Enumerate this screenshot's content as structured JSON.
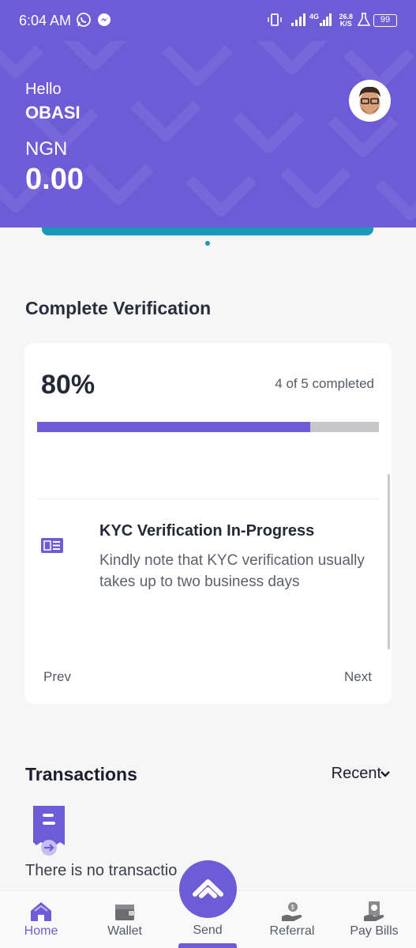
{
  "status_bar": {
    "time": "6:04 AM",
    "network": "4G",
    "speed": "26.8",
    "speed_unit": "K/S",
    "battery": "99"
  },
  "header": {
    "greeting": "Hello",
    "name": "OBASI",
    "currency": "NGN",
    "balance": "0.00"
  },
  "verification": {
    "title": "Complete Verification",
    "percent": "80%",
    "progress_fraction": 0.8,
    "count_text": "4 of 5 completed",
    "step": {
      "title": "KYC Verification In-Progress",
      "description": "Kindly note that KYC verification usually takes up to two business days"
    },
    "prev_label": "Prev",
    "next_label": "Next"
  },
  "transactions": {
    "title": "Transactions",
    "filter": "Recent",
    "empty_text": "There is no transactio"
  },
  "bottom_nav": [
    {
      "label": "Home",
      "icon": "home-icon",
      "active": true
    },
    {
      "label": "Wallet",
      "icon": "wallet-icon"
    },
    {
      "label": "Send",
      "icon": "send-icon"
    },
    {
      "label": "Referral",
      "icon": "referral-icon"
    },
    {
      "label": "Pay Bills",
      "icon": "pay-bills-icon"
    }
  ],
  "colors": {
    "brand": "#6e5bd6",
    "accent": "#1a98b8",
    "progress_track": "#c7c7c9"
  }
}
